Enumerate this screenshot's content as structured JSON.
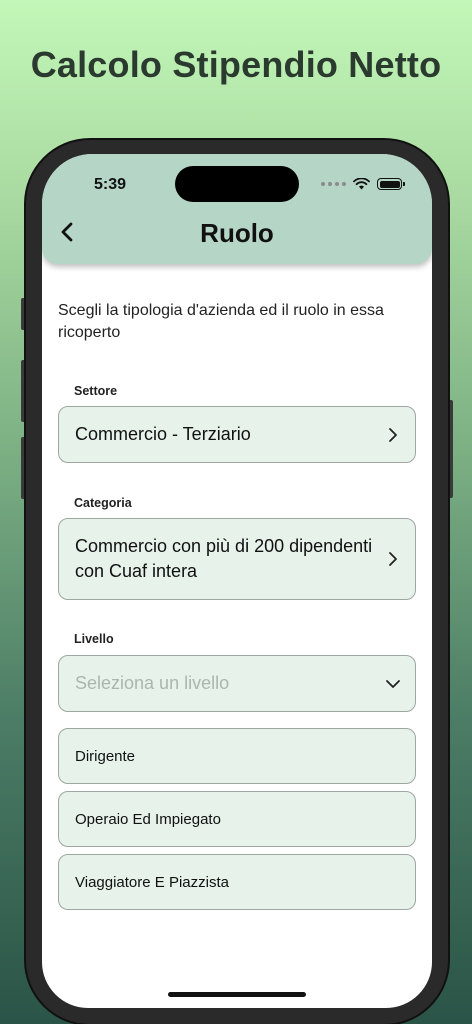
{
  "banner": {
    "title": "Calcolo Stipendio Netto"
  },
  "status_bar": {
    "time": "5:39"
  },
  "nav": {
    "title": "Ruolo"
  },
  "intro": "Scegli la tipologia d'azienda ed il ruolo in essa ricoperto",
  "settore": {
    "label": "Settore",
    "value": "Commercio - Terziario"
  },
  "categoria": {
    "label": "Categoria",
    "value": "Commercio con più di 200 dipendenti con Cuaf intera"
  },
  "livello": {
    "label": "Livello",
    "placeholder": "Seleziona un livello",
    "options": [
      "Dirigente",
      "Operaio Ed Impiegato",
      "Viaggiatore E Piazzista"
    ]
  },
  "colors": {
    "accent": "#b5d5c6",
    "field_bg": "#e6f2ea"
  },
  "icons": [
    "back-chevron-icon",
    "chevron-right-icon",
    "chevron-down-icon",
    "wifi-icon",
    "battery-icon"
  ]
}
